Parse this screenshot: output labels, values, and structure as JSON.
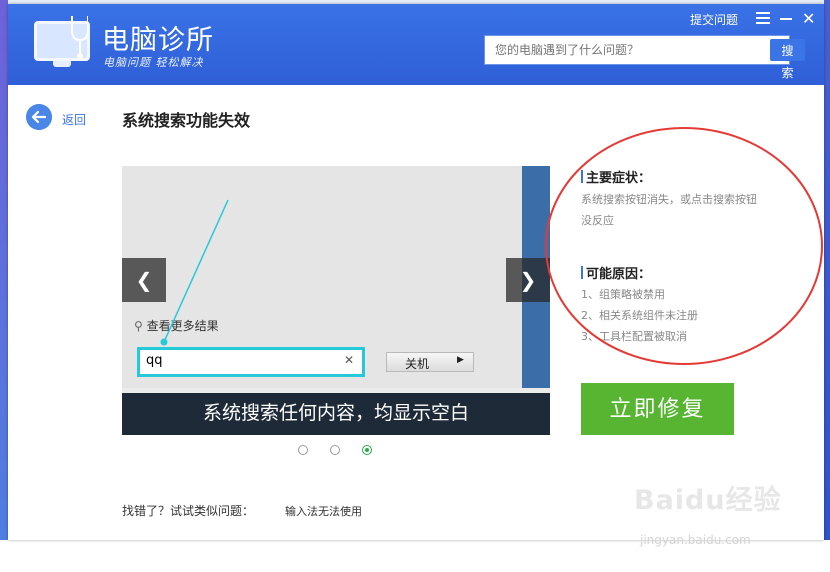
{
  "app": {
    "name": "电脑诊所",
    "slogan": "电脑问题 轻松解决",
    "feedback": "提交问题",
    "search_placeholder": "您的电脑遇到了什么问题？",
    "search_button": "搜索"
  },
  "nav": {
    "back": "返回"
  },
  "page": {
    "title": "系统搜索功能失效"
  },
  "slideshow": {
    "more_results": "查看更多结果",
    "query": "qq",
    "shutdown": "关机",
    "caption": "系统搜索任何内容，均显示空白",
    "slides": 3,
    "active_slide": 3
  },
  "info": {
    "symptoms_title": "主要症状：",
    "symptoms_line1": "系统搜索按钮消失，或点击搜索按钮",
    "symptoms_line2": "没反应",
    "causes_title": "可能原因：",
    "causes": [
      "1、组策略被禁用",
      "2、相关系统组件未注册",
      "3、工具栏配置被取消"
    ]
  },
  "actions": {
    "repair": "立即修复"
  },
  "similar": {
    "prefix": "找错了？试试类似问题：",
    "link": "输入法无法使用"
  },
  "watermark": {
    "brand": "Baidu经验",
    "url": "jingyan.baidu.com"
  },
  "colors": {
    "header": "#2f5fd7",
    "accent": "#3b74e5",
    "repair": "#57b532",
    "highlight": "#25c9d8",
    "annotation": "#e53935"
  }
}
